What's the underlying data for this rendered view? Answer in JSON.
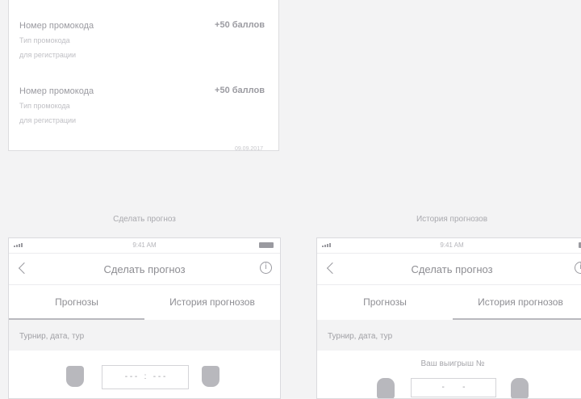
{
  "promo_list": {
    "items": [
      {
        "title": "Номер промокода",
        "points": "+50 баллов",
        "subtitle_line1": "Тип промокода",
        "subtitle_line2": "для регистрации"
      },
      {
        "title": "Номер промокода",
        "points": "+50 баллов",
        "subtitle_line1": "Тип промокода",
        "subtitle_line2": "для регистрации"
      }
    ],
    "footer_date": "09.09.2017"
  },
  "screens": [
    {
      "caption": "Сделать прогноз",
      "status_time": "9:41 AM",
      "nav_title": "Сделать прогноз",
      "tabs": [
        "Прогнозы",
        "История прогнозов"
      ],
      "active_tab": 0,
      "section_label": "Турнир, дата, тур",
      "score_placeholder_left": "- - -",
      "score_separator": ":",
      "score_placeholder_right": "- - -"
    },
    {
      "caption": "История прогнозов",
      "status_time": "9:41 AM",
      "nav_title": "Сделать прогноз",
      "tabs": [
        "Прогнозы",
        "История прогнозов"
      ],
      "active_tab": 1,
      "section_label": "Турнир, дата, тур",
      "win_text": "Ваш выигрыш №",
      "score_placeholder_left": "-",
      "score_placeholder_right": "-"
    }
  ],
  "colors": {
    "background": "#f3f3f4",
    "card": "#ffffff",
    "text": "#8e8e93",
    "muted": "#c0c0c5",
    "tab_underline": "#b9b9be"
  },
  "icons": [
    "signal-icon",
    "battery-icon",
    "back-chevron-icon",
    "info-icon",
    "team-shield-icon"
  ]
}
